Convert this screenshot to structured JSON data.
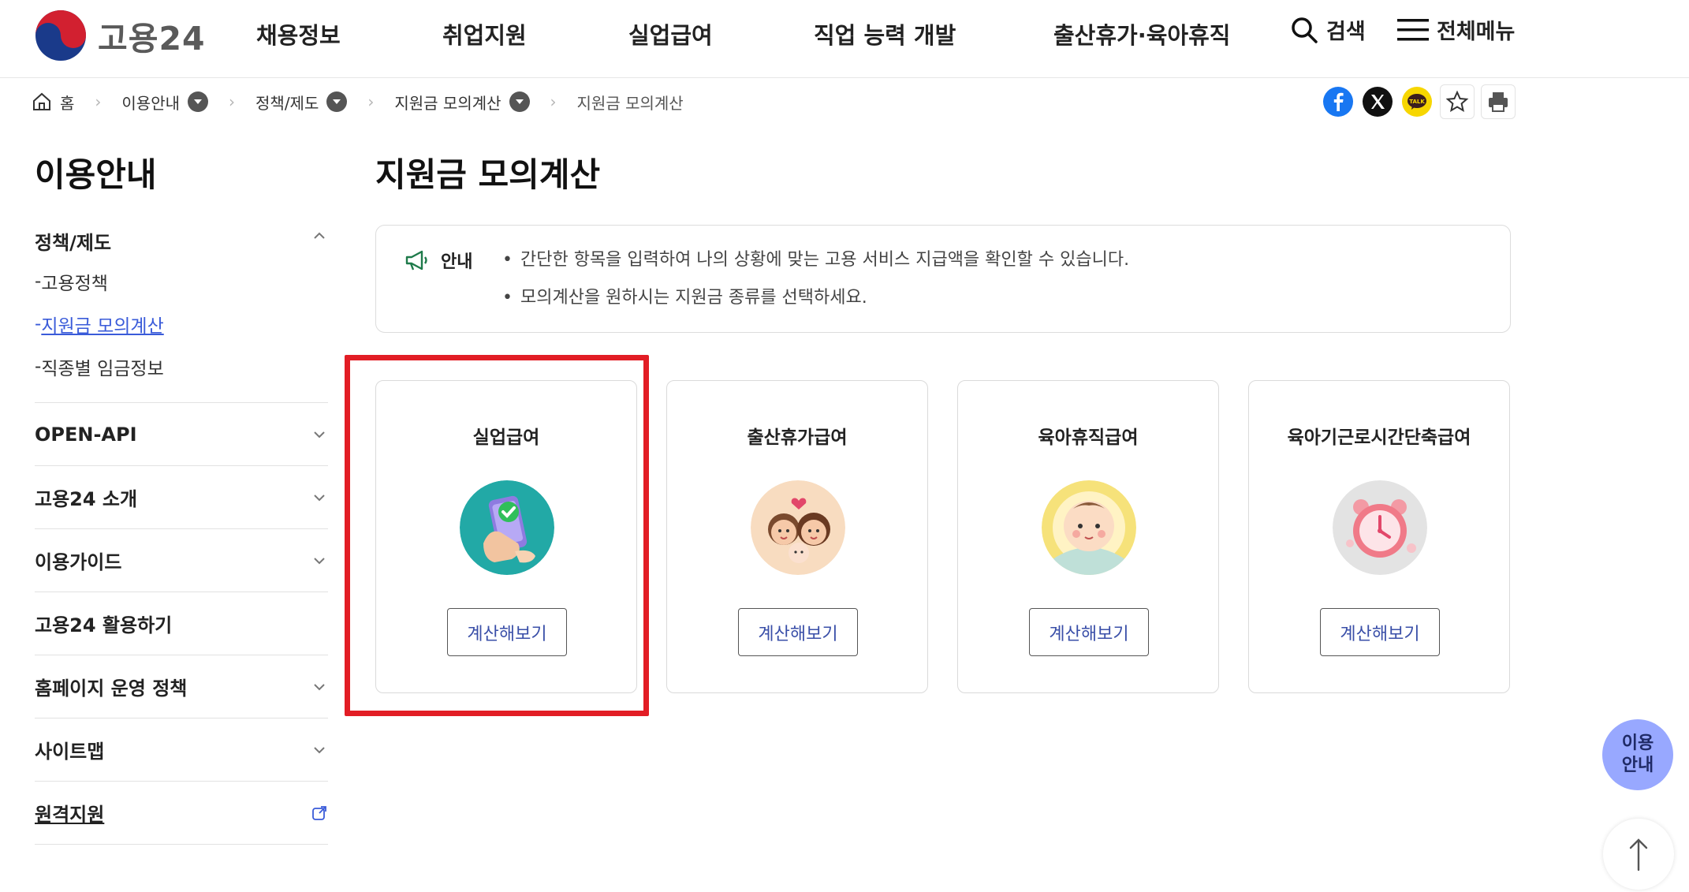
{
  "header": {
    "logo_text": "고용24",
    "nav": [
      "채용정보",
      "취업지원",
      "실업급여",
      "직업 능력 개발",
      "출산휴가·육아휴직"
    ],
    "search_label": "검색",
    "menu_label": "전체메뉴"
  },
  "breadcrumb": {
    "home": "홈",
    "items": [
      "이용안내",
      "정책/제도",
      "지원금 모의계산"
    ],
    "current": "지원금 모의계산"
  },
  "sidebar": {
    "title": "이용안내",
    "groups": [
      {
        "label": "정책/제도",
        "sub": [
          "고용정책",
          "지원금 모의계산",
          "직종별 임금정보"
        ]
      },
      {
        "label": "OPEN-API"
      },
      {
        "label": "고용24 소개"
      },
      {
        "label": "이용가이드"
      },
      {
        "label": "고용24 활용하기"
      },
      {
        "label": "홈페이지 운영 정책"
      },
      {
        "label": "사이트맵"
      },
      {
        "label": "원격지원"
      }
    ]
  },
  "main": {
    "title": "지원금 모의계산",
    "notice": {
      "label": "안내",
      "lines": [
        "간단한 항목을 입력하여 나의 상황에 맞는 고용 서비스 지급액을 확인할 수 있습니다.",
        "모의계산을 원하시는 지원금 종류를 선택하세요."
      ]
    },
    "cards": [
      {
        "title": "실업급여",
        "button": "계산해보기",
        "icon": "phone-check-icon"
      },
      {
        "title": "출산휴가급여",
        "button": "계산해보기",
        "icon": "family-icon"
      },
      {
        "title": "육아휴직급여",
        "button": "계산해보기",
        "icon": "baby-icon"
      },
      {
        "title": "육아기근로시간단축급여",
        "button": "계산해보기",
        "icon": "alarm-clock-icon"
      }
    ]
  },
  "floating": {
    "guide_line1": "이용",
    "guide_line2": "안내"
  },
  "colors": {
    "accent": "#3a5bd9",
    "highlight": "#e21d25",
    "guide_bg": "#98a8ff"
  }
}
